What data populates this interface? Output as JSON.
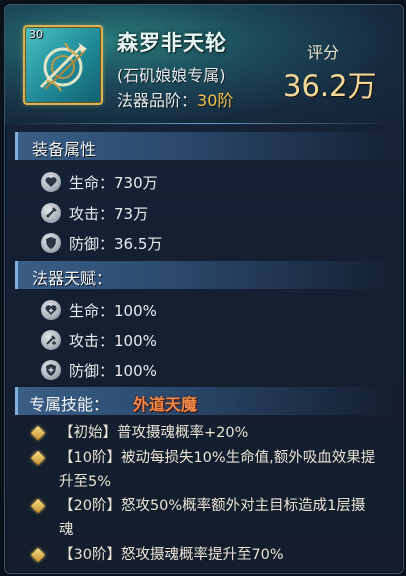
{
  "item": {
    "level": "30",
    "name": "森罗非天轮",
    "exclusive": "(石矶娘娘专属)",
    "grade_label": "法器品阶：",
    "grade_value": "30阶"
  },
  "score": {
    "label": "评分",
    "value": "36.2万"
  },
  "equip_attrs": {
    "title": "装备属性",
    "rows": [
      {
        "icon": "heart-icon",
        "label": "生命：",
        "value": "730万"
      },
      {
        "icon": "sword-icon",
        "label": "攻击：",
        "value": "73万"
      },
      {
        "icon": "shield-icon",
        "label": "防御：",
        "value": "36.5万"
      }
    ]
  },
  "talent": {
    "title": "法器天赋：",
    "rows": [
      {
        "icon": "heart-plus-icon",
        "label": "生命：",
        "value": "100%"
      },
      {
        "icon": "attack-boost-icon",
        "label": "攻击：",
        "value": "100%"
      },
      {
        "icon": "shield-plus-icon",
        "label": "防御：",
        "value": "100%"
      }
    ]
  },
  "skill": {
    "label": "专属技能：",
    "name": "外道天魔",
    "effects": [
      "【初始】普攻摄魂概率+20%",
      "【10阶】被动每损失10%生命值,额外吸血效果提升至5%",
      "【20阶】怒攻50%概率额外对主目标造成1层摄魂",
      "【30阶】怒攻摄魂概率提升至70%"
    ]
  },
  "colors": {
    "accent": "#f2c14b",
    "skill_name": "#f08a4c",
    "border": "#d9b455"
  }
}
